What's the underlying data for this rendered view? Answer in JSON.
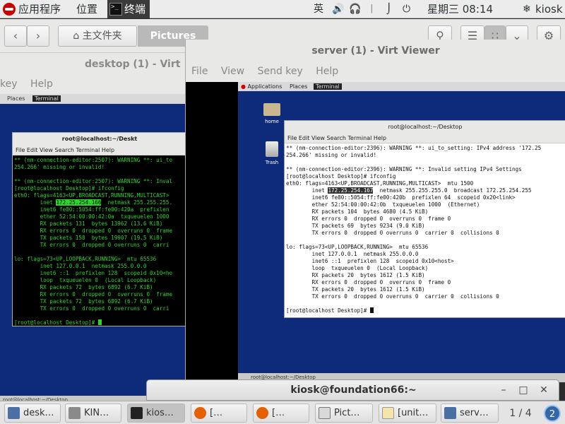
{
  "topbar": {
    "applications": "应用程序",
    "places": "位置",
    "terminal_app": "终端",
    "input_method": "英",
    "datetime": "星期三 08:14",
    "user": "kiosk"
  },
  "nautilus": {
    "home_label": "主文件夹",
    "current_folder": "Pictures"
  },
  "desktop_viewer": {
    "title": "desktop (1) - Virt",
    "menu_partial_1": "key",
    "menu_partial_2": "Help",
    "guest_panel": "Places",
    "guest_panel_terminal": "Terminal",
    "terminal_title": "root@localhost:~/Deskt",
    "terminal_menu": "File  Edit  View  Search  Terminal  Help",
    "bottom": "root@localhost:~/Desktop",
    "lines_before": "** (nm-connection-editor:2507): WARNING **: ui_to\n254.266' missing or invalid!\n\n** (nm-connection-editor:2507): WARNING **: Inval\n[root@localhost Desktop]# ifconfig\neth0: flags=4163<UP,BROADCAST,RUNNING,MULTICAST>\n        inet ",
    "ip_highlight": "172.25.254.166",
    "lines_after": "  netmask 255.255.255.\n        inet6 fe80::5054:ff:fe00:420a  prefixlen\n        ether 52:54:00:00:42:0a  txqueuelen 1000\n        RX packets 131  bytes 13962 (13.6 KiB)\n        RX errors 0  dropped 0  overruns 0  frame\n        TX packets 158  bytes 19907 (19.5 KiB)\n        TX errors 0  dropped 0 overruns 0  carri\n\nlo: flags=73<UP,LOOPBACK,RUNNING>  mtu 65536\n        inet 127.0.0.1  netmask 255.0.0.0\n        inet6 ::1  prefixlen 128  scopeid 0x10<ho\n        loop  txqueuelen 0  (Local Loopback)\n        RX packets 72  bytes 6892 (6.7 KiB)\n        RX errors 0  dropped 0  overruns 0  frame\n        TX packets 72  bytes 6892 (6.7 KiB)\n        TX errors 0  dropped 0 overruns 0  carri\n\n[root@localhost Desktop]# "
  },
  "server_viewer": {
    "title": "server (1) - Virt Viewer",
    "menu": [
      "File",
      "View",
      "Send key",
      "Help"
    ],
    "guest_panel_apps": "Applications",
    "guest_panel_places": "Places",
    "guest_panel_terminal": "Terminal",
    "icon_home": "home",
    "icon_trash": "Trash",
    "terminal_title": "root@localhost:~/Desktop",
    "terminal_menu": "File  Edit  View  Search  Terminal  Help",
    "bottom": "root@localhost:~/Desktop",
    "lines_before": "** (nm-connection-editor:2396): WARNING **: ui_to_setting: IPv4 address '172.25\n254.266' missing or invalid!\n\n** (nm-connection-editor:2396): WARNING **: Invalid setting IPv4 Settings\n[root@localhost Desktop]# ifconfig\neth0: flags=4163<UP,BROADCAST,RUNNING,MULTICAST>  mtu 1500\n        inet ",
    "ip_highlight": "172.25.254.167",
    "lines_after": "  netmask 255.255.255.0  broadcast 172.25.254.255\n        inet6 fe80::5054:ff:fe00:420b  prefixlen 64  scopeid 0x20<link>\n        ether 52:54:00:00:42:0b  txqueuelen 1000  (Ethernet)\n        RX packets 104  bytes 4680 (4.5 KiB)\n        RX errors 0  dropped 0  overruns 0  frame 0\n        TX packets 69  bytes 9234 (9.0 KiB)\n        TX errors 0  dropped 0 overruns 0  carrier 0  collisions 0\n\nlo: flags=73<UP,LOOPBACK,RUNNING>  mtu 65536\n        inet 127.0.0.1  netmask 255.0.0.0\n        inet6 ::1  prefixlen 128  scopeid 0x10<host>\n        loop  txqueuelen 0  (Local Loopback)\n        RX packets 20  bytes 1612 (1.5 KiB)\n        RX errors 0  dropped 0  overruns 0  frame 0\n        TX packets 20  bytes 1612 (1.5 KiB)\n        TX errors 0  dropped 0 overruns 0  carrier 0  collisions 0\n\n[root@localhost Desktop]# "
  },
  "kiosk_terminal": {
    "title": "kiosk@foundation66:~"
  },
  "taskbar": {
    "tasks": [
      "desk…",
      "KIN…",
      "kios…",
      "[…",
      "[…",
      "Pict…",
      "[unit…",
      "serv…"
    ],
    "pager": "1 / 4",
    "notification_count": "2"
  }
}
